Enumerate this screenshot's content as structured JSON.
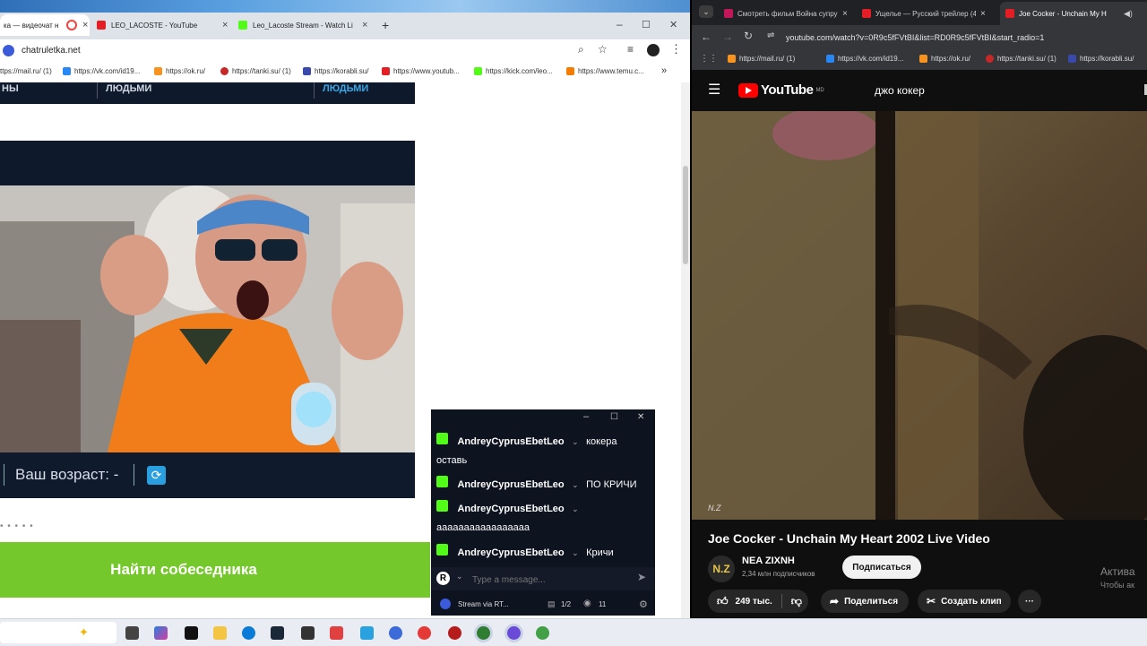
{
  "left_browser": {
    "tabs": [
      {
        "label": "ка — видеочат н",
        "active": false
      },
      {
        "label": "LEO_LACOSTE - YouTube",
        "active": false
      },
      {
        "label": "Leo_Lacoste Stream - Watch Li",
        "active": true
      }
    ],
    "new_tab": "+",
    "window_controls": {
      "minimize": "–",
      "maximize": "☐",
      "close": "✕"
    },
    "address": "chatruletka.net",
    "bookmarks": [
      "ttps://mail.ru/ (1)",
      "https://vk.com/id19...",
      "https://ok.ru/",
      "https://tanki.su/ (1)",
      "https://korabli.su/",
      "https://www.youtub...",
      "https://kick.com/leo...",
      "https://www.temu.c..."
    ],
    "page": {
      "top_fragments": [
        "НЫ",
        "ЛЮДЬМИ",
        "ЛЮДЬМИ"
      ],
      "age_label": "Ваш возраст: -",
      "dots": "• • • • •",
      "find_button": "Найти собеседника"
    }
  },
  "chat": {
    "messages": [
      {
        "user": "AndreyCyprusEbetLeo",
        "text": "кокера",
        "cont": "оставь"
      },
      {
        "user": "AndreyCyprusEbetLeo",
        "text": "ПО КРИЧИ",
        "cont": ""
      },
      {
        "user": "AndreyCyprusEbetLeo",
        "text": "",
        "cont": "ааааааааааааааааа"
      },
      {
        "user": "AndreyCyprusEbetLeo",
        "text": "Кричи",
        "cont": ""
      }
    ],
    "input_placeholder": "Type a message...",
    "rt_badge": "R",
    "footer_label": "Stream via RT...",
    "footer_count": "1/2",
    "viewers": "11"
  },
  "right_browser": {
    "tabs": [
      {
        "label": "Смотреть фильм Война супру",
        "active": false
      },
      {
        "label": "Ущелье — Русский трейлер (4",
        "active": false
      },
      {
        "label": "Joe Cocker - Unchain My H",
        "active": true
      }
    ],
    "address": "youtube.com/watch?v=0R9c5fFVtBI&list=RD0R9c5fFVtBI&start_radio=1",
    "bookmarks": [
      "https://mail.ru/ (1)",
      "https://vk.com/id19...",
      "https://ok.ru/",
      "https://tanki.su/ (1)",
      "https://korabli.su/"
    ],
    "youtube": {
      "logo_text": "YouTube",
      "logo_sup": "MD",
      "search_query": "джо кокер",
      "watermark": "N.Z",
      "video_title": "Joe Cocker - Unchain My Heart 2002 Live Video",
      "channel_avatar": "N.Z",
      "channel_name": "NEA ZIXNH",
      "subscribers": "2,34 млн подписчиков",
      "subscribe": "Подписаться",
      "likes": "249 тыс.",
      "share": "Поделиться",
      "clip": "Создать клип",
      "more": "···",
      "activate_1": "Актива",
      "activate_2": "Чтобы ак"
    }
  },
  "colors": {
    "green_button": "#75c82b",
    "navy": "#0e1a2c",
    "kick_green": "#53fc18",
    "youtube_red": "#ff0000"
  }
}
